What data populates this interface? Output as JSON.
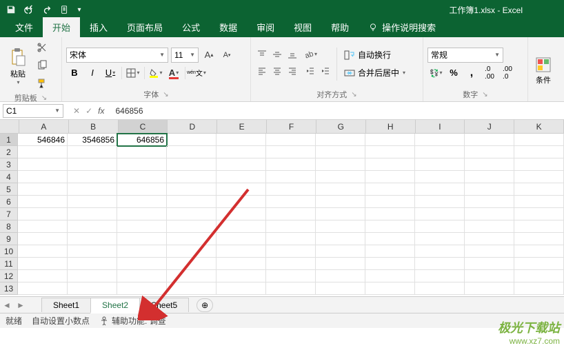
{
  "title": "工作簿1.xlsx - Excel",
  "tabs": {
    "file": "文件",
    "home": "开始",
    "insert": "插入",
    "pagelayout": "页面布局",
    "formulas": "公式",
    "data": "数据",
    "review": "审阅",
    "view": "视图",
    "help": "帮助",
    "tellme": "操作说明搜索"
  },
  "ribbon": {
    "paste": "粘贴",
    "clipboard_label": "剪贴板",
    "font": {
      "name": "宋体",
      "size": "11",
      "label": "字体"
    },
    "alignment": {
      "wrap": "自动换行",
      "merge": "合并后居中",
      "label": "对齐方式"
    },
    "number": {
      "format": "常规",
      "label": "数字"
    },
    "conditional": "条件"
  },
  "formula_bar": {
    "cell_ref": "C1",
    "value": "646856"
  },
  "columns": [
    "A",
    "B",
    "C",
    "D",
    "E",
    "F",
    "G",
    "H",
    "I",
    "J",
    "K"
  ],
  "rows": [
    "1",
    "2",
    "3",
    "4",
    "5",
    "6",
    "7",
    "8",
    "9",
    "10",
    "11",
    "12",
    "13"
  ],
  "cells": {
    "A1": "546846",
    "B1": "3546856",
    "C1": "646856"
  },
  "sheets": {
    "s1": "Sheet1",
    "s2": "Sheet2",
    "s5": "Sheet5"
  },
  "status": {
    "ready": "就绪",
    "decimal": "自动设置小数点",
    "accessibility": "辅助功能: 调查"
  },
  "watermark": {
    "line1": "极光下载站",
    "line2": "www.xz7.com"
  },
  "glyph": {
    "dropdown": "▾",
    "dropdown_sm": "▼",
    "nav_prev": "◄",
    "nav_next": "►",
    "plus": "⊕",
    "launcher": "⌐"
  }
}
